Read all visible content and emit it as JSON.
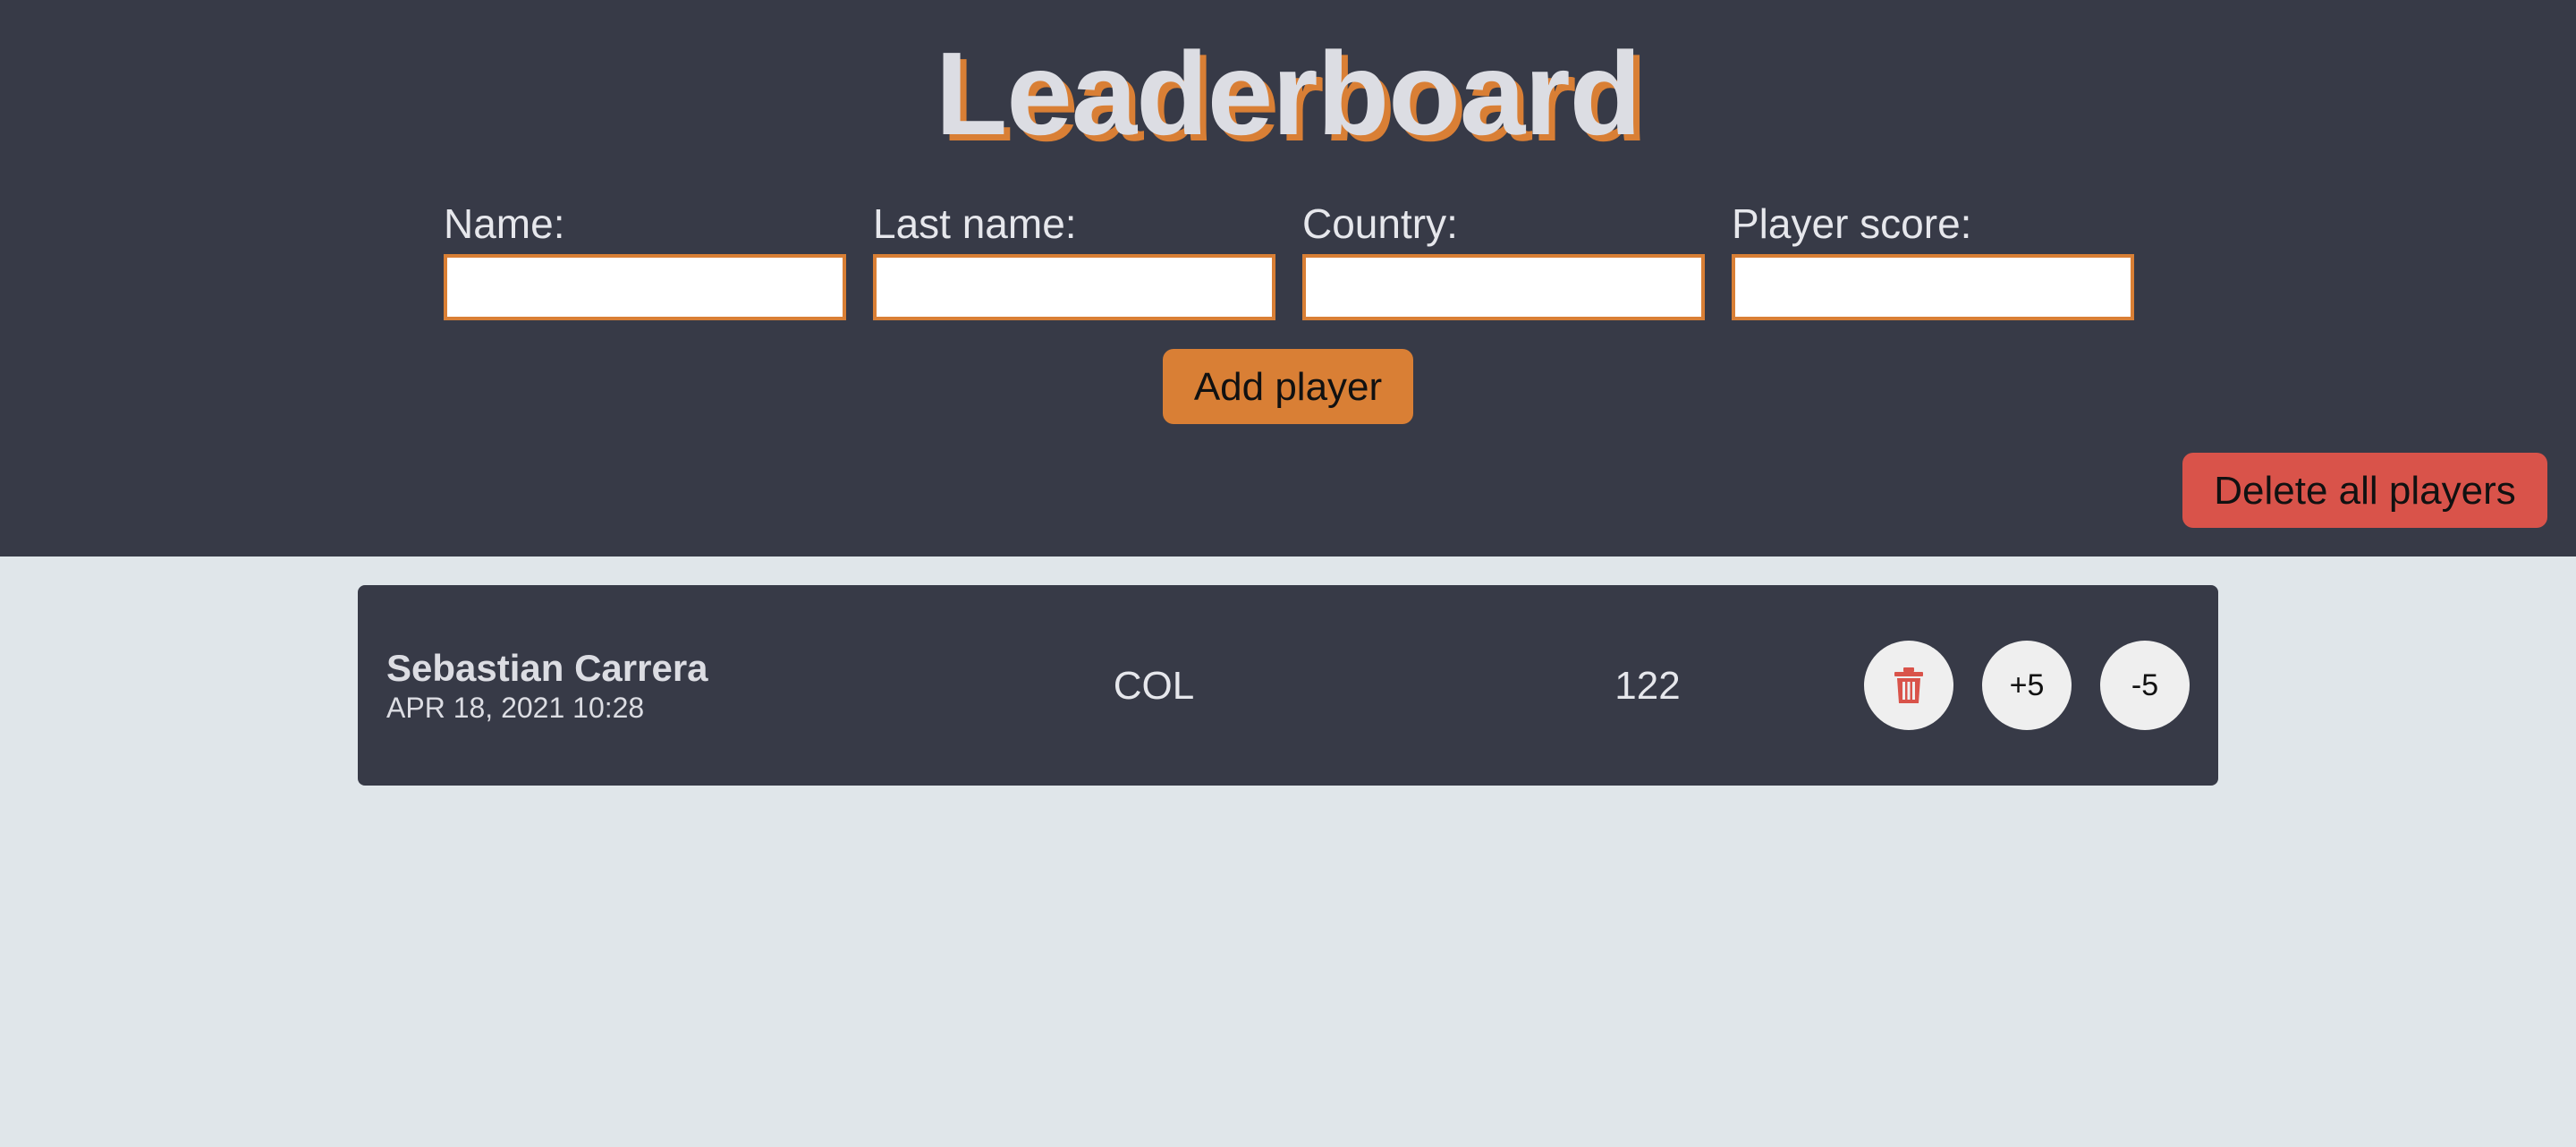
{
  "header": {
    "title": "Leaderboard"
  },
  "form": {
    "fields": [
      {
        "label": "Name:",
        "value": ""
      },
      {
        "label": "Last name:",
        "value": ""
      },
      {
        "label": "Country:",
        "value": ""
      },
      {
        "label": "Player score:",
        "value": ""
      }
    ],
    "add_label": "Add player",
    "delete_all_label": "Delete all players"
  },
  "players": [
    {
      "name": "Sebastian Carrera",
      "date": "APR 18, 2021 10:28",
      "country": "COL",
      "score": "122",
      "plus_label": "+5",
      "minus_label": "-5"
    }
  ],
  "colors": {
    "accent": "#d97f35",
    "danger": "#d9534a",
    "header_bg": "#373a47",
    "page_bg": "#e0e6ea"
  },
  "icons": {
    "delete": "trash-icon"
  }
}
